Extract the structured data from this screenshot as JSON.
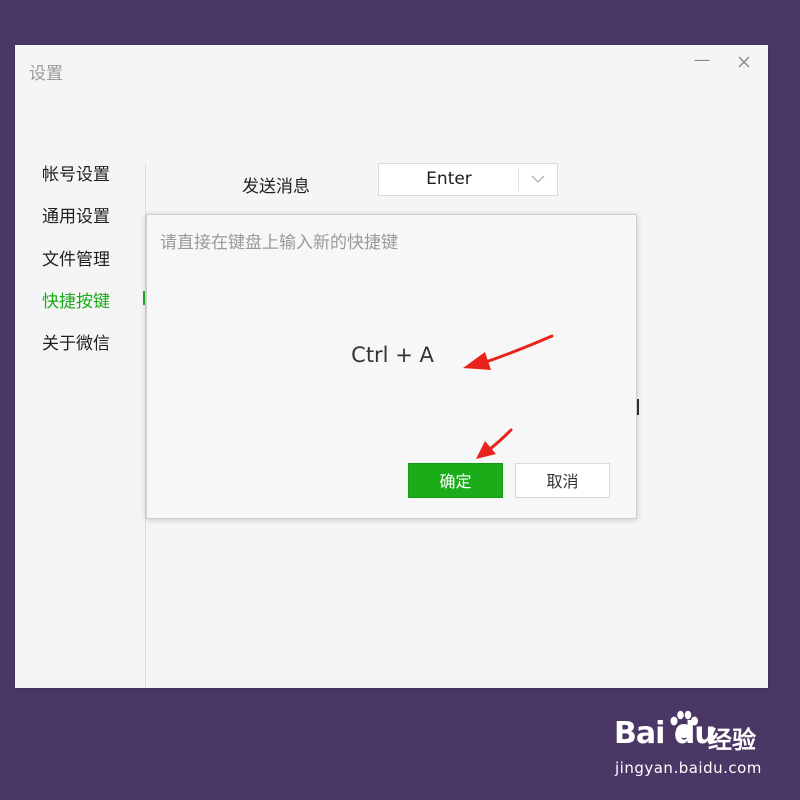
{
  "window": {
    "title": "设置",
    "minimize_symbol": "—"
  },
  "sidebar": {
    "items": [
      {
        "label": "帐号设置"
      },
      {
        "label": "通用设置"
      },
      {
        "label": "文件管理"
      },
      {
        "label": "快捷按键",
        "active": true
      },
      {
        "label": "关于微信"
      }
    ]
  },
  "shortcut_row": {
    "label": "发送消息",
    "selected_value": "Enter"
  },
  "dialog": {
    "prompt": "请直接在键盘上输入新的快捷键",
    "shortcut": "Ctrl + A",
    "confirm_label": "确定",
    "cancel_label": "取消"
  },
  "watermark": {
    "brand": "Bai du",
    "brand_cn": "经验",
    "url": "jingyan.baidu.com"
  },
  "colors": {
    "accent": "#1aad19",
    "background": "#4a3766",
    "annotation_arrow": "#e8231b"
  },
  "icons": [
    "close-icon",
    "minimize-icon",
    "chevron-down-icon",
    "paw-icon",
    "arrow-annotation-icon"
  ]
}
